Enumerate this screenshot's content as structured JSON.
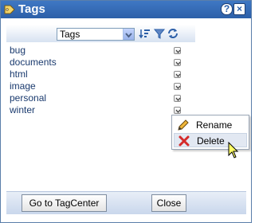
{
  "window": {
    "title": "Tags",
    "title_icon": "tag-icon",
    "help_label": "?",
    "close_label": "×"
  },
  "toolbar": {
    "select_value": "Tags",
    "icons": [
      "sort-icon",
      "filter-icon",
      "refresh-icon"
    ]
  },
  "tags": [
    {
      "label": "bug"
    },
    {
      "label": "documents"
    },
    {
      "label": "html"
    },
    {
      "label": "image"
    },
    {
      "label": "personal"
    },
    {
      "label": "winter"
    }
  ],
  "context_menu": {
    "items": [
      {
        "label": "Rename",
        "icon": "pencil-icon"
      },
      {
        "label": "Delete",
        "icon": "delete-icon",
        "highlighted": true
      }
    ]
  },
  "footer": {
    "tagcenter_label": "Go to TagCenter",
    "close_label": "Close"
  },
  "colors": {
    "titlebar": "#2c5fa8",
    "link_text": "#1a3a6e",
    "menu_highlight": "#e2e8f2",
    "delete_red": "#d42a2a"
  }
}
